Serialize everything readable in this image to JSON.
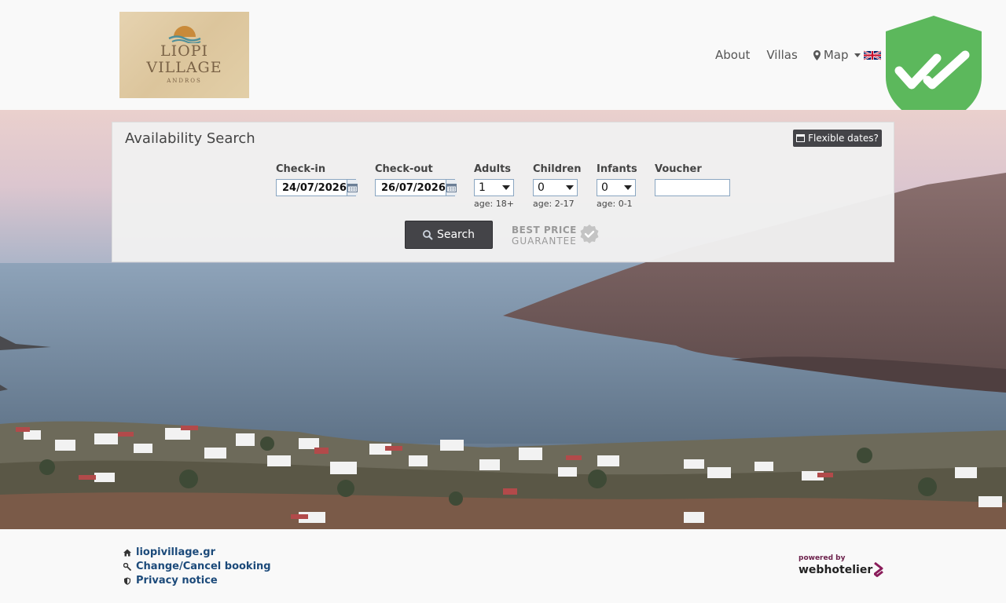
{
  "brand": {
    "logo_name_line1": "LIOPI",
    "logo_name_line2": "VILLAGE",
    "logo_sub": "ANDROS"
  },
  "nav": {
    "about": "About",
    "villas": "Villas",
    "map": "Map",
    "language_icon": "uk-flag-icon"
  },
  "search": {
    "title": "Availability Search",
    "flexible_label": "Flexible dates?",
    "checkin_label": "Check-in",
    "checkin_value": "24/07/2026",
    "checkout_label": "Check-out",
    "checkout_value": "26/07/2026",
    "adults_label": "Adults",
    "adults_value": "1",
    "adults_age": "age: 18+",
    "children_label": "Children",
    "children_value": "0",
    "children_age": "age: 2-17",
    "infants_label": "Infants",
    "infants_value": "0",
    "infants_age": "age: 0-1",
    "voucher_label": "Voucher",
    "voucher_value": "",
    "search_button": "Search",
    "best_price_line1": "BEST PRICE",
    "best_price_line2": "GUARANTEE"
  },
  "footer": {
    "links": [
      {
        "label": "liopivillage.gr",
        "icon": "home-icon"
      },
      {
        "label": "Change/Cancel booking",
        "icon": "wrench-icon"
      },
      {
        "label": "Privacy notice",
        "icon": "shield-icon"
      }
    ],
    "powered_by": "powered by",
    "provider": "webhotelier"
  },
  "colors": {
    "shield_green": "#5cb85c",
    "button_dark": "#444448",
    "link_blue": "#1c4a7a",
    "provider_accent": "#8a1c5a"
  }
}
